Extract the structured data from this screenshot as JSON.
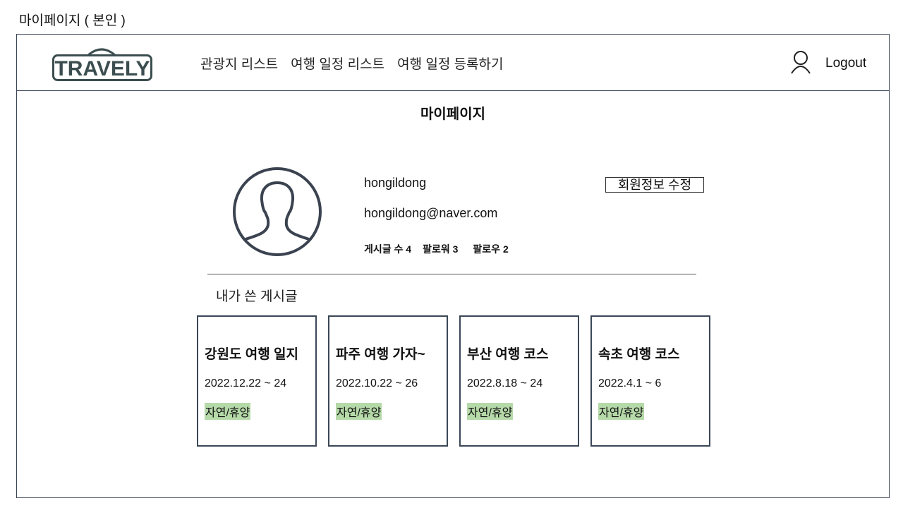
{
  "page_caption": "마이페이지 ( 본인 )",
  "header": {
    "logo_text": "TRAVELY",
    "nav": [
      "관광지 리스트",
      "여행 일정 리스트",
      "여행 일정 등록하기"
    ],
    "logout_label": "Logout",
    "brand_color": "#3b4d4f"
  },
  "main": {
    "title": "마이페이지",
    "profile": {
      "username": "hongildong",
      "email": "hongildong@naver.com",
      "stats": [
        "게시글 수 4",
        "팔로워 3",
        "팔로우 2"
      ],
      "edit_button": "회원정보 수정"
    },
    "section_title": "내가 쓴 게시글",
    "posts": [
      {
        "title": "강원도 여행 일지",
        "date": "2022.12.22 ~ 24",
        "tag": "자연/휴양"
      },
      {
        "title": "파주 여행 가자~",
        "date": "2022.10.22 ~ 26",
        "tag": "자연/휴양"
      },
      {
        "title": "부산 여행 코스",
        "date": "2022.8.18 ~ 24",
        "tag": "자연/휴양"
      },
      {
        "title": "속초 여행 코스",
        "date": "2022.4.1 ~ 6",
        "tag": "자연/휴양"
      }
    ],
    "tag_color": "#b5d9a8"
  }
}
